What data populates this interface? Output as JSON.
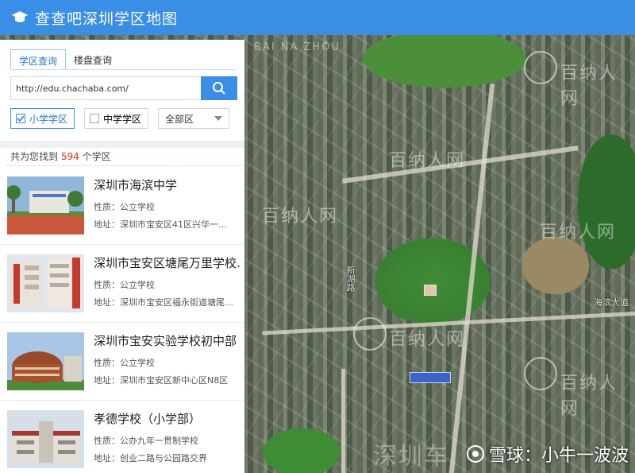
{
  "header": {
    "title": "查查吧深圳学区地图",
    "color": "#3a8ee6"
  },
  "tabs": [
    {
      "label": "学区查询",
      "active": true
    },
    {
      "label": "楼盘查询",
      "active": false
    }
  ],
  "search": {
    "value": "http://edu.chachaba.com/",
    "button_icon": "search-icon"
  },
  "filters": {
    "primary": {
      "label": "小学学区",
      "checked": true
    },
    "middle": {
      "label": "中学学区",
      "checked": false
    },
    "district": {
      "selected": "全部区"
    }
  },
  "results": {
    "prefix": "共为您找到",
    "count": "594",
    "suffix": "个学区"
  },
  "schools": [
    {
      "name": "深圳市海滨中学",
      "nature_label": "性质：",
      "nature": "公立学校",
      "addr_label": "地址：",
      "address": "深圳市宝安区41区兴华一…"
    },
    {
      "name": "深圳市宝安区塘尾万里学校…",
      "nature_label": "性质：",
      "nature": "公立学校",
      "addr_label": "地址：",
      "address": "深圳市宝安区福永街道塘尾…"
    },
    {
      "name": "深圳市宝安实验学校初中部",
      "nature_label": "性质：",
      "nature": "公立学校",
      "addr_label": "地址：",
      "address": "深圳市宝安区新中心区N8区"
    },
    {
      "name": "孝德学校（小学部）",
      "nature_label": "性质：",
      "nature": "公办九年一贯制学校",
      "addr_label": "地址：",
      "address": "创业二路与公园路交界"
    }
  ],
  "map": {
    "watermark": "百纳人网",
    "watermark_sub": "BAI NA ZHOU",
    "road_labels": [
      "新湖路",
      "海滨大道"
    ],
    "footer_watermark": "雪球：小牛一波波",
    "footer_bg_text": "深圳车",
    "footer_icon": "snowball-logo-icon"
  }
}
